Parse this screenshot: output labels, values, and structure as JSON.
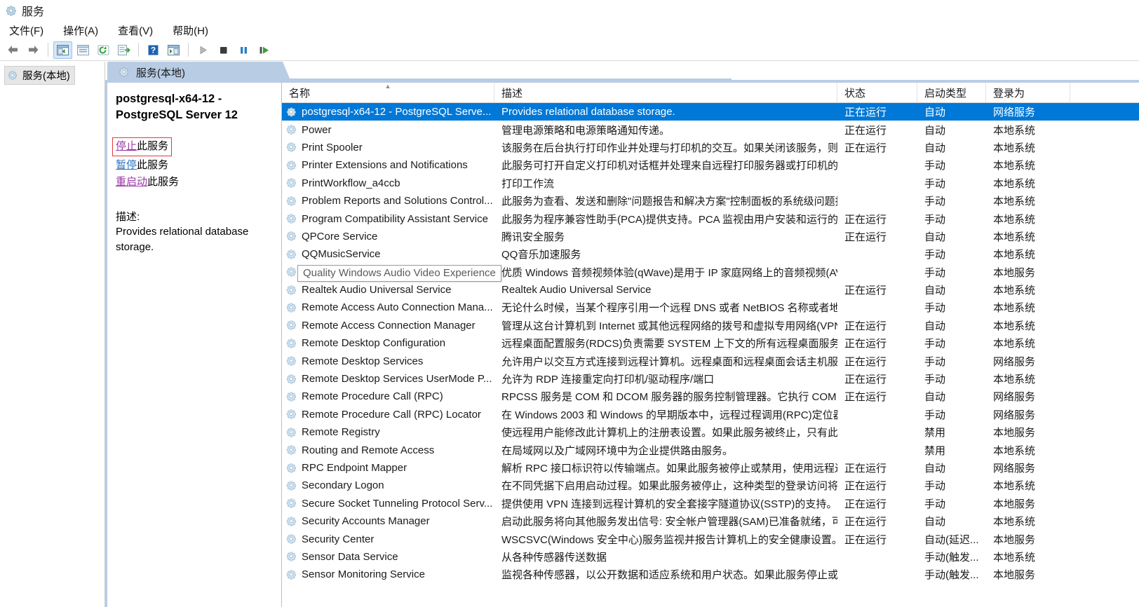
{
  "window": {
    "title": "服务",
    "icon": "services-gear-icon"
  },
  "menubar": [
    {
      "label": "文件(F)",
      "name": "menu-file"
    },
    {
      "label": "操作(A)",
      "name": "menu-action"
    },
    {
      "label": "查看(V)",
      "name": "menu-view"
    },
    {
      "label": "帮助(H)",
      "name": "menu-help"
    }
  ],
  "toolbar": [
    {
      "name": "back-button",
      "icon": "arrow-left-icon"
    },
    {
      "name": "forward-button",
      "icon": "arrow-right-icon"
    },
    {
      "name": "show-hide-console-tree-button",
      "icon": "console-tree-icon",
      "active": true
    },
    {
      "name": "properties-button",
      "icon": "properties-icon"
    },
    {
      "name": "refresh-button",
      "icon": "refresh-icon"
    },
    {
      "name": "export-list-button",
      "icon": "export-list-icon"
    },
    {
      "name": "help-button",
      "icon": "help-icon"
    },
    {
      "name": "show-action-pane-button",
      "icon": "action-pane-icon"
    },
    {
      "name": "start-service-button",
      "icon": "play-icon"
    },
    {
      "name": "stop-service-button",
      "icon": "stop-icon"
    },
    {
      "name": "pause-service-button",
      "icon": "pause-icon"
    },
    {
      "name": "restart-service-button",
      "icon": "restart-icon"
    }
  ],
  "tree": {
    "items": [
      {
        "label": "服务(本地)",
        "name": "tree-item-services-local",
        "selected": true
      }
    ]
  },
  "tab": {
    "label": "服务(本地)",
    "icon": "services-gear-icon"
  },
  "details": {
    "service_title": "postgresql-x64-12 - PostgreSQL Server 12",
    "actions": [
      {
        "link": "停止",
        "suffix": "此服务",
        "name": "stop-this-service-link",
        "color": "purple",
        "boxed": true
      },
      {
        "link": "暂停",
        "suffix": "此服务",
        "name": "pause-this-service-link",
        "color": "blue",
        "boxed": false
      },
      {
        "link": "重启动",
        "suffix": "此服务",
        "name": "restart-this-service-link",
        "color": "purple",
        "boxed": false
      }
    ],
    "description_label": "描述:",
    "description_text": "Provides relational database storage."
  },
  "list": {
    "columns": [
      {
        "label": "名称",
        "name": "column-header-name",
        "sorted": "asc"
      },
      {
        "label": "描述",
        "name": "column-header-description",
        "sorted": ""
      },
      {
        "label": "状态",
        "name": "column-header-status",
        "sorted": ""
      },
      {
        "label": "启动类型",
        "name": "column-header-startup-type",
        "sorted": ""
      },
      {
        "label": "登录为",
        "name": "column-header-logon-as",
        "sorted": ""
      }
    ],
    "selected_index": 0,
    "tooltip": {
      "text": "Quality Windows Audio Video Experience",
      "row_index": 9
    },
    "rows": [
      {
        "name": "postgresql-x64-12 - PostgreSQL Serve...",
        "description": "Provides relational database storage.",
        "status": "正在运行",
        "startup": "自动",
        "logon": "网络服务"
      },
      {
        "name": "Power",
        "description": "管理电源策略和电源策略通知传递。",
        "status": "正在运行",
        "startup": "自动",
        "logon": "本地系统"
      },
      {
        "name": "Print Spooler",
        "description": "该服务在后台执行打印作业并处理与打印机的交互。如果关闭该服务，则...",
        "status": "正在运行",
        "startup": "自动",
        "logon": "本地系统"
      },
      {
        "name": "Printer Extensions and Notifications",
        "description": "此服务可打开自定义打印机对话框并处理来自远程打印服务器或打印机的...",
        "status": "",
        "startup": "手动",
        "logon": "本地系统"
      },
      {
        "name": "PrintWorkflow_a4ccb",
        "description": "打印工作流",
        "status": "",
        "startup": "手动",
        "logon": "本地系统"
      },
      {
        "name": "Problem Reports and Solutions Control...",
        "description": "此服务为查看、发送和删除\"问题报告和解决方案\"控制面板的系统级问题报...",
        "status": "",
        "startup": "手动",
        "logon": "本地系统"
      },
      {
        "name": "Program Compatibility Assistant Service",
        "description": "此服务为程序兼容性助手(PCA)提供支持。PCA 监视由用户安装和运行的...",
        "status": "正在运行",
        "startup": "手动",
        "logon": "本地系统"
      },
      {
        "name": "QPCore Service",
        "description": "腾讯安全服务",
        "status": "正在运行",
        "startup": "自动",
        "logon": "本地系统"
      },
      {
        "name": "QQMusicService",
        "description": "QQ音乐加速服务",
        "status": "",
        "startup": "手动",
        "logon": "本地系统"
      },
      {
        "name": "Quality Windows Audio Video Experience",
        "description": "优质 Windows 音频视频体验(qWave)是用于 IP 家庭网络上的音频视频(AV...",
        "status": "",
        "startup": "手动",
        "logon": "本地服务"
      },
      {
        "name": "Realtek Audio Universal Service",
        "description": "Realtek Audio Universal Service",
        "status": "正在运行",
        "startup": "自动",
        "logon": "本地系统"
      },
      {
        "name": "Remote Access Auto Connection Mana...",
        "description": "无论什么时候，当某个程序引用一个远程 DNS 或者 NetBIOS 名称或者地...",
        "status": "",
        "startup": "手动",
        "logon": "本地系统"
      },
      {
        "name": "Remote Access Connection Manager",
        "description": "管理从这台计算机到 Internet 或其他远程网络的拨号和虚拟专用网络(VPN...",
        "status": "正在运行",
        "startup": "自动",
        "logon": "本地系统"
      },
      {
        "name": "Remote Desktop Configuration",
        "description": "远程桌面配置服务(RDCS)负责需要 SYSTEM 上下文的所有远程桌面服务和...",
        "status": "正在运行",
        "startup": "手动",
        "logon": "本地系统"
      },
      {
        "name": "Remote Desktop Services",
        "description": "允许用户以交互方式连接到远程计算机。远程桌面和远程桌面会话主机服...",
        "status": "正在运行",
        "startup": "手动",
        "logon": "网络服务"
      },
      {
        "name": "Remote Desktop Services UserMode P...",
        "description": "允许为 RDP 连接重定向打印机/驱动程序/端口",
        "status": "正在运行",
        "startup": "手动",
        "logon": "本地系统"
      },
      {
        "name": "Remote Procedure Call (RPC)",
        "description": "RPCSS 服务是 COM 和 DCOM 服务器的服务控制管理器。它执行 COM ...",
        "status": "正在运行",
        "startup": "自动",
        "logon": "网络服务"
      },
      {
        "name": "Remote Procedure Call (RPC) Locator",
        "description": "在 Windows 2003 和 Windows 的早期版本中，远程过程调用(RPC)定位器...",
        "status": "",
        "startup": "手动",
        "logon": "网络服务"
      },
      {
        "name": "Remote Registry",
        "description": "使远程用户能修改此计算机上的注册表设置。如果此服务被终止，只有此...",
        "status": "",
        "startup": "禁用",
        "logon": "本地服务"
      },
      {
        "name": "Routing and Remote Access",
        "description": "在局域网以及广域网环境中为企业提供路由服务。",
        "status": "",
        "startup": "禁用",
        "logon": "本地系统"
      },
      {
        "name": "RPC Endpoint Mapper",
        "description": "解析 RPC 接口标识符以传输端点。如果此服务被停止或禁用，使用远程过...",
        "status": "正在运行",
        "startup": "自动",
        "logon": "网络服务"
      },
      {
        "name": "Secondary Logon",
        "description": "在不同凭据下启用启动过程。如果此服务被停止，这种类型的登录访问将...",
        "status": "正在运行",
        "startup": "手动",
        "logon": "本地系统"
      },
      {
        "name": "Secure Socket Tunneling Protocol Serv...",
        "description": "提供使用 VPN 连接到远程计算机的安全套接字隧道协议(SSTP)的支持。如...",
        "status": "正在运行",
        "startup": "手动",
        "logon": "本地服务"
      },
      {
        "name": "Security Accounts Manager",
        "description": "启动此服务将向其他服务发出信号: 安全帐户管理器(SAM)已准备就绪，可...",
        "status": "正在运行",
        "startup": "自动",
        "logon": "本地系统"
      },
      {
        "name": "Security Center",
        "description": "WSCSVC(Windows 安全中心)服务监视并报告计算机上的安全健康设置。...",
        "status": "正在运行",
        "startup": "自动(延迟...",
        "logon": "本地服务"
      },
      {
        "name": "Sensor Data Service",
        "description": "从各种传感器传送数据",
        "status": "",
        "startup": "手动(触发...",
        "logon": "本地系统"
      },
      {
        "name": "Sensor Monitoring Service",
        "description": "监视各种传感器，以公开数据和适应系统和用户状态。如果此服务停止或...",
        "status": "",
        "startup": "手动(触发...",
        "logon": "本地服务"
      }
    ]
  },
  "colors": {
    "selection": "#0078d7",
    "tab_header": "#b8cce4",
    "link_purple": "#9b36a8",
    "link_blue": "#2b6fbb",
    "highlight_box": "#e03b3b"
  }
}
